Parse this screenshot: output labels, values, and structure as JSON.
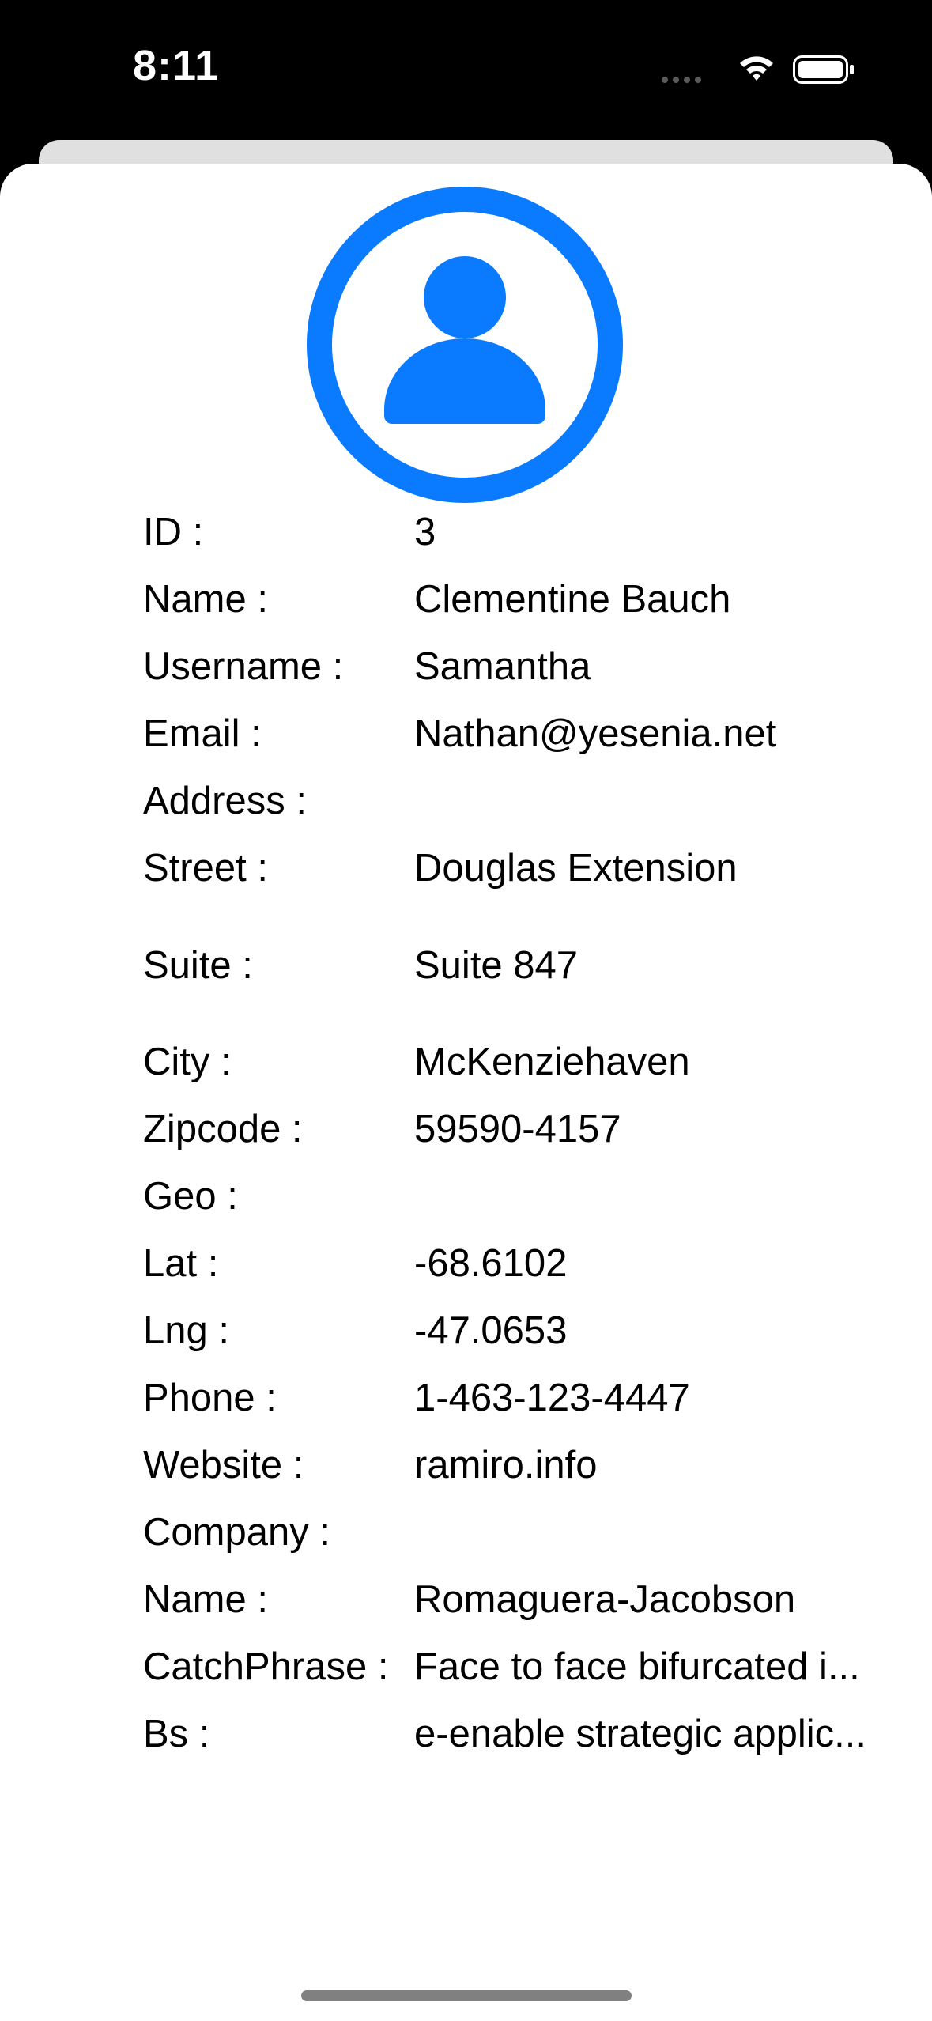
{
  "status_bar": {
    "time": "8:11",
    "icons": [
      "signal-icon",
      "wifi-icon",
      "battery-icon"
    ]
  },
  "colors": {
    "accent": "#0a7aff",
    "sheet_background": "#ffffff",
    "back_card": "#e0e0e0",
    "status_bar_background": "#000000"
  },
  "avatar": {
    "icon": "person-circle-icon"
  },
  "details": [
    {
      "label": "ID :",
      "value": "3"
    },
    {
      "label": "Name :",
      "value": "Clementine Bauch"
    },
    {
      "label": "Username :",
      "value": "Samantha"
    },
    {
      "label": "Email :",
      "value": "Nathan@yesenia.net"
    },
    {
      "label": "Address :",
      "value": ""
    },
    {
      "label": "Street :",
      "value": "Douglas Extension"
    },
    {
      "label": "Suite :",
      "value": "Suite 847"
    },
    {
      "label": "City :",
      "value": "McKenziehaven"
    },
    {
      "label": "Zipcode :",
      "value": "59590-4157"
    },
    {
      "label": "Geo :",
      "value": ""
    },
    {
      "label": "Lat :",
      "value": "-68.6102"
    },
    {
      "label": "Lng :",
      "value": "-47.0653"
    },
    {
      "label": "Phone :",
      "value": "1-463-123-4447"
    },
    {
      "label": "Website :",
      "value": "ramiro.info"
    },
    {
      "label": "Company :",
      "value": ""
    },
    {
      "label": "Name :",
      "value": "Romaguera-Jacobson"
    },
    {
      "label": "CatchPhrase :",
      "value": "Face to face bifurcated i..."
    },
    {
      "label": "Bs :",
      "value": "e-enable strategic applic..."
    }
  ]
}
